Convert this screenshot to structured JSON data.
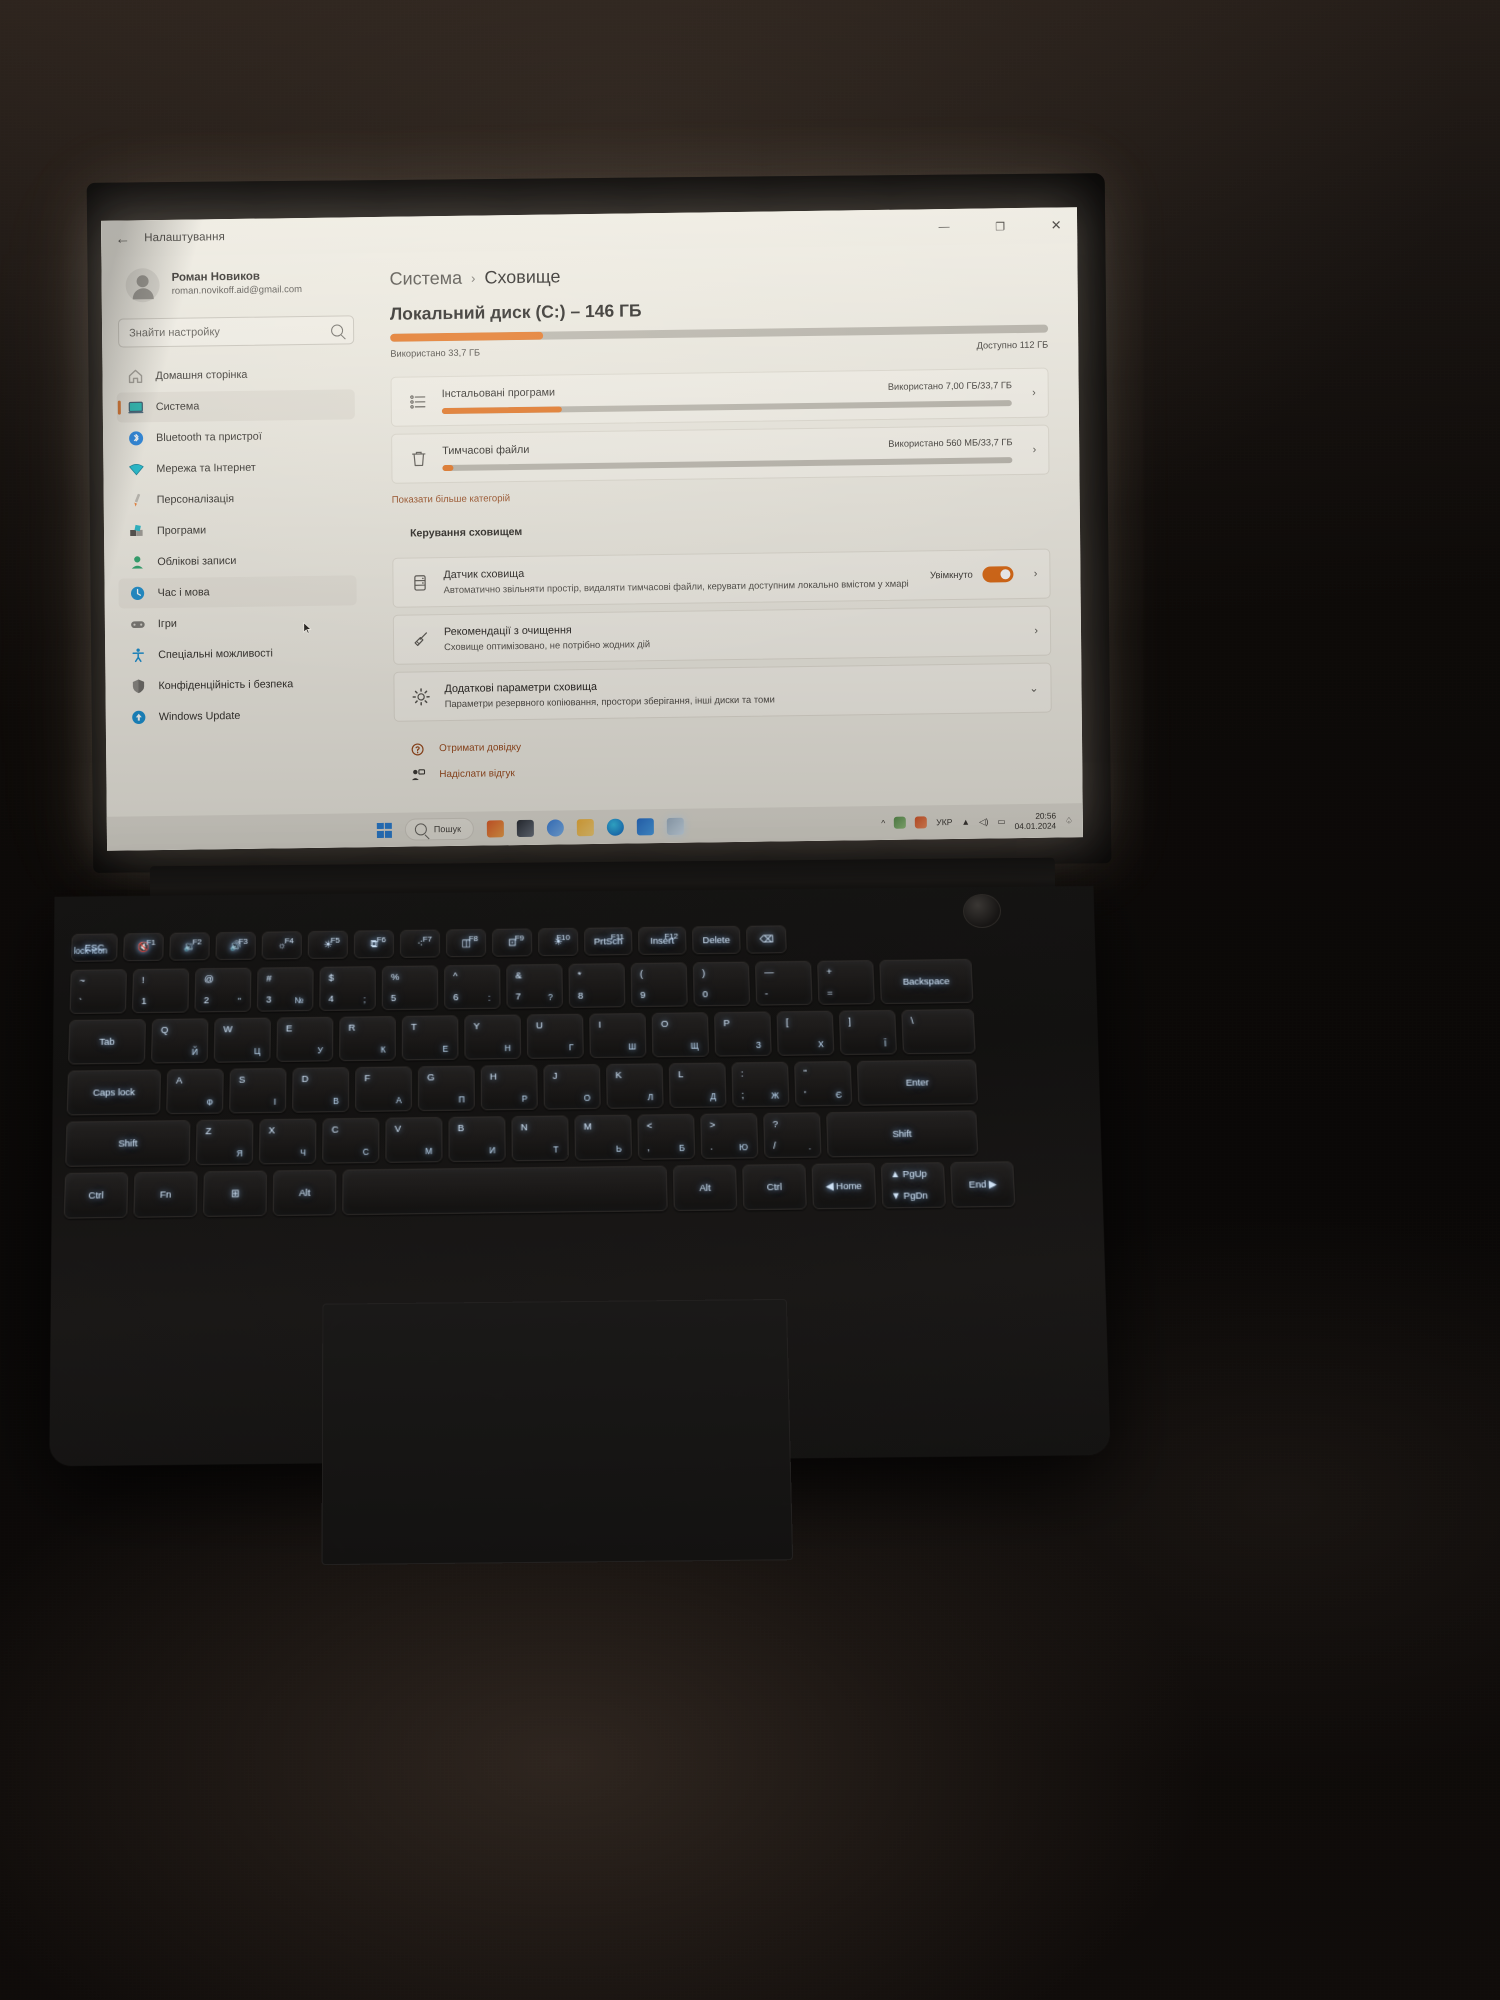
{
  "window": {
    "title": "Налаштування",
    "back_icon": "←",
    "minimize": "—",
    "maximize": "❐",
    "close": "✕"
  },
  "account": {
    "name": "Роман Новиков",
    "email": "roman.novikoff.aid@gmail.com"
  },
  "search": {
    "placeholder": "Знайти настройку",
    "value": "",
    "icon": "search-icon"
  },
  "sidebar": {
    "items": [
      {
        "label": "Домашня сторінка",
        "icon": "home-icon",
        "state": "normal"
      },
      {
        "label": "Система",
        "icon": "system-icon",
        "state": "active"
      },
      {
        "label": "Bluetooth та пристрої",
        "icon": "bluetooth-icon",
        "state": "normal"
      },
      {
        "label": "Мережа та Інтернет",
        "icon": "network-icon",
        "state": "normal"
      },
      {
        "label": "Персоналізація",
        "icon": "brush-icon",
        "state": "normal"
      },
      {
        "label": "Програми",
        "icon": "apps-icon",
        "state": "normal"
      },
      {
        "label": "Облікові записи",
        "icon": "accounts-icon",
        "state": "normal"
      },
      {
        "label": "Час і мова",
        "icon": "time-icon",
        "state": "hover"
      },
      {
        "label": "Ігри",
        "icon": "gaming-icon",
        "state": "normal"
      },
      {
        "label": "Спеціальні можливості",
        "icon": "accessibility-icon",
        "state": "normal"
      },
      {
        "label": "Конфіденційність і безпека",
        "icon": "privacy-icon",
        "state": "normal"
      },
      {
        "label": "Windows Update",
        "icon": "update-icon",
        "state": "normal"
      }
    ]
  },
  "breadcrumb": {
    "parent": "Система",
    "separator": "›",
    "current": "Сховище"
  },
  "disk": {
    "title": "Локальний диск (C:) – 146 ГБ",
    "used_label": "Використано 33,7 ГБ",
    "free_label": "Доступно 112 ГБ",
    "used_percent": 23.2,
    "bar_color": "#e8711a",
    "track_color": "#b9b5ac"
  },
  "categories": [
    {
      "title": "Інстальовані програми",
      "value": "Використано 7,00 ГБ/33,7 ГБ",
      "percent": 21,
      "icon": "app-list-icon",
      "chevron": "›"
    },
    {
      "title": "Тимчасові файли",
      "value": "Використано 560 МБ/33,7 ГБ",
      "percent": 2,
      "icon": "trash-icon",
      "chevron": "›"
    }
  ],
  "show_more": "Показати більше категорій",
  "management": {
    "heading": "Керування сховищем",
    "items": [
      {
        "title": "Датчик сховища",
        "desc": "Автоматично звільняти простір, видаляти тимчасові файли, керувати доступним локально вмістом у хмарі",
        "icon": "storage-sense-icon",
        "toggle_label": "Увімкнуто",
        "toggle_on": true,
        "chevron": "›"
      },
      {
        "title": "Рекомендації з очищення",
        "desc": "Сховище оптимізовано, не потрібно жодних дій",
        "icon": "broom-icon",
        "chevron": "›"
      },
      {
        "title": "Додаткові параметри сховища",
        "desc": "Параметри резервного копіювання, простори зберігання, інші диски та томи",
        "icon": "gear-icon",
        "chevron": "⌄"
      }
    ]
  },
  "footer_links": [
    {
      "label": "Отримати довідку",
      "icon": "help-icon"
    },
    {
      "label": "Надіслати відгук",
      "icon": "feedback-icon"
    }
  ],
  "taskbar": {
    "start_icon": "windows-logo-icon",
    "search_placeholder": "Пошук",
    "search_icon": "search-icon",
    "tray": {
      "chevron": "^",
      "language": "УКР",
      "wifi_icon": "wifi-icon",
      "volume_icon": "volume-icon",
      "battery_icon": "battery-icon",
      "notification_icon": "bell-icon"
    },
    "clock": {
      "time": "20:56",
      "date": "04.01.2024"
    }
  },
  "keyboard": {
    "fn_row": [
      {
        "main": "ESC",
        "tr": "",
        "sub": "lock-icon"
      },
      {
        "main": "🔇",
        "tr": "F1"
      },
      {
        "main": "🔉",
        "tr": "F2"
      },
      {
        "main": "🔊",
        "tr": "F3"
      },
      {
        "main": "☼",
        "tr": "F4"
      },
      {
        "main": "☀",
        "tr": "F5"
      },
      {
        "main": "⧉",
        "tr": "F6"
      },
      {
        "main": "⁖",
        "tr": "F7"
      },
      {
        "main": "◫",
        "tr": "F8"
      },
      {
        "main": "⊡",
        "tr": "F9"
      },
      {
        "main": "☀",
        "tr": "F10"
      },
      {
        "main": "PrtScn",
        "tr": "F11"
      },
      {
        "main": "Insert",
        "tr": "F12"
      },
      {
        "main": "Delete",
        "tr": ""
      },
      {
        "main": "⌫",
        "tr": ""
      }
    ],
    "row1": [
      {
        "top": "~",
        "bl": "`"
      },
      {
        "top": "!",
        "bl": "1"
      },
      {
        "top": "@",
        "bl": "2",
        "sub": "\""
      },
      {
        "top": "#",
        "bl": "3",
        "sub": "№"
      },
      {
        "top": "$",
        "bl": "4",
        "sub": ";"
      },
      {
        "top": "%",
        "bl": "5"
      },
      {
        "top": "^",
        "bl": "6",
        "sub": ":"
      },
      {
        "top": "&",
        "bl": "7",
        "sub": "?"
      },
      {
        "top": "*",
        "bl": "8"
      },
      {
        "top": "(",
        "bl": "9"
      },
      {
        "top": ")",
        "bl": "0"
      },
      {
        "top": "—",
        "bl": "-"
      },
      {
        "top": "+",
        "bl": "="
      },
      {
        "main": "Backspace"
      }
    ],
    "row2": [
      {
        "main": "Tab"
      },
      {
        "top": "Q",
        "sub": "Й"
      },
      {
        "top": "W",
        "sub": "Ц"
      },
      {
        "top": "E",
        "sub": "У"
      },
      {
        "top": "R",
        "sub": "К"
      },
      {
        "top": "T",
        "sub": "Е"
      },
      {
        "top": "Y",
        "sub": "Н"
      },
      {
        "top": "U",
        "sub": "Г"
      },
      {
        "top": "I",
        "sub": "Ш"
      },
      {
        "top": "O",
        "sub": "Щ"
      },
      {
        "top": "P",
        "sub": "З"
      },
      {
        "top": "[",
        "sub": "Х"
      },
      {
        "top": "]",
        "sub": "Ї"
      },
      {
        "top": "\\",
        "sub": ""
      }
    ],
    "row3": [
      {
        "main": "Caps lock"
      },
      {
        "top": "A",
        "sub": "Ф"
      },
      {
        "top": "S",
        "sub": "І"
      },
      {
        "top": "D",
        "sub": "В"
      },
      {
        "top": "F",
        "sub": "А"
      },
      {
        "top": "G",
        "sub": "П"
      },
      {
        "top": "H",
        "sub": "Р"
      },
      {
        "top": "J",
        "sub": "О"
      },
      {
        "top": "K",
        "sub": "Л"
      },
      {
        "top": "L",
        "sub": "Д"
      },
      {
        "top": ":",
        "bl": ";",
        "sub": "Ж"
      },
      {
        "top": "\"",
        "bl": "'",
        "sub": "Є"
      },
      {
        "main": "Enter"
      }
    ],
    "row4": [
      {
        "main": "Shift"
      },
      {
        "top": "Z",
        "sub": "Я"
      },
      {
        "top": "X",
        "sub": "Ч"
      },
      {
        "top": "C",
        "sub": "С"
      },
      {
        "top": "V",
        "sub": "М"
      },
      {
        "top": "B",
        "sub": "И"
      },
      {
        "top": "N",
        "sub": "Т"
      },
      {
        "top": "M",
        "sub": "Ь"
      },
      {
        "top": "<",
        "bl": ",",
        "sub": "Б"
      },
      {
        "top": ">",
        "bl": ".",
        "sub": "Ю"
      },
      {
        "top": "?",
        "bl": "/",
        "sub": "."
      },
      {
        "main": "Shift"
      }
    ],
    "row5": [
      {
        "main": "Ctrl"
      },
      {
        "main": "Fn"
      },
      {
        "main": "⊞"
      },
      {
        "main": "Alt"
      },
      {
        "main": ""
      },
      {
        "main": "Alt"
      },
      {
        "main": "Ctrl"
      },
      {
        "main": "◀ Home"
      },
      {
        "top": "▲ PgUp",
        "bl": "▼ PgDn"
      },
      {
        "main": "End ▶"
      }
    ]
  }
}
